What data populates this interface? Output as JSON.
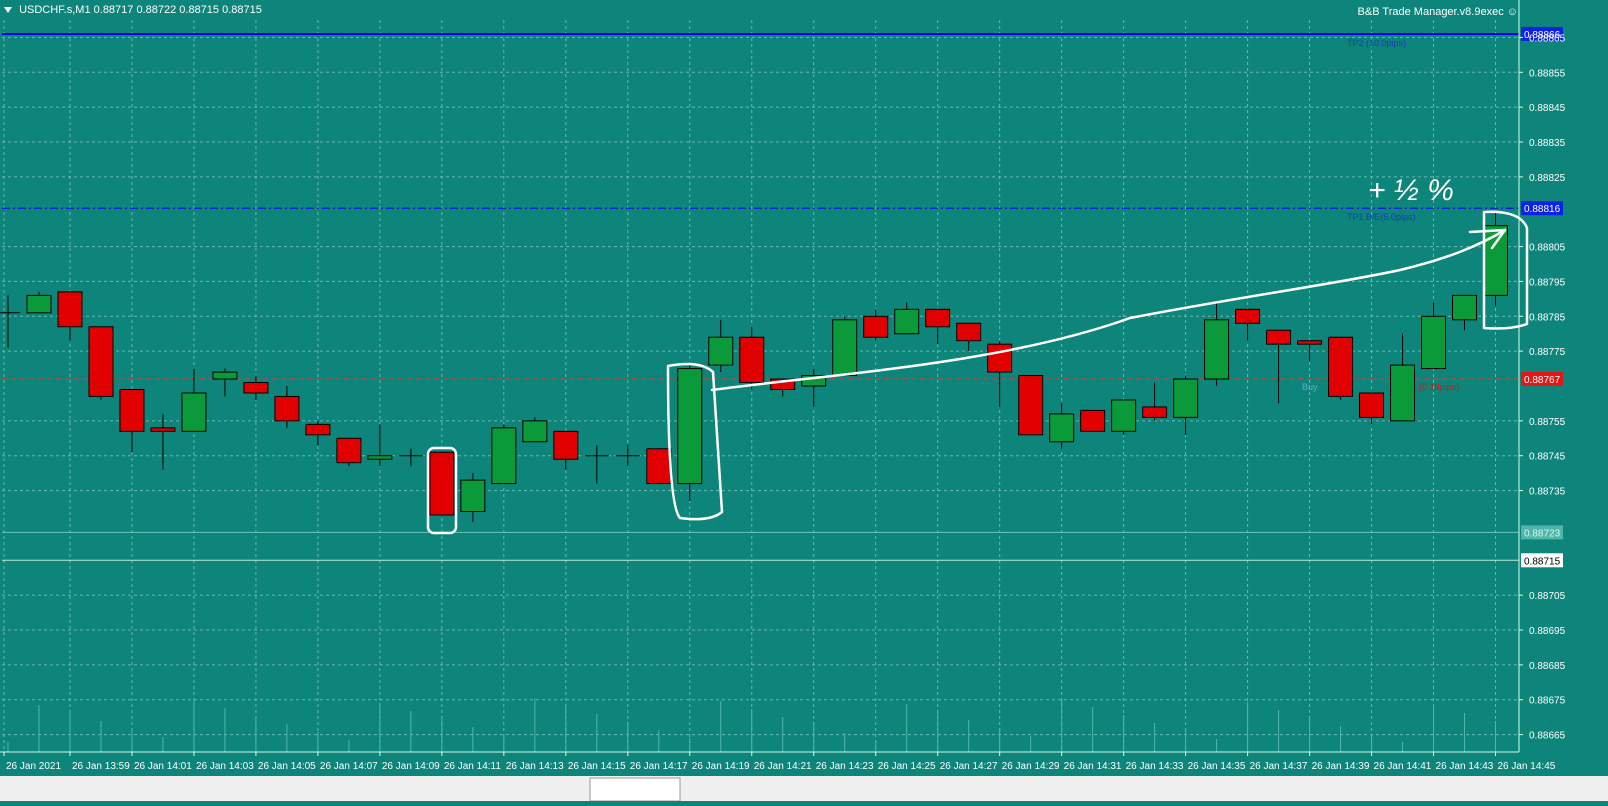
{
  "header": {
    "symbol": "USDCHF.s,M1",
    "ohlc": "0.88717 0.88722 0.88715 0.88715",
    "expert": "B&B Trade Manager.v8.9exec"
  },
  "annotation": {
    "handwritten": "+ ½ %"
  },
  "colors": {
    "background": "#0e857a",
    "grid": "#67b8b0",
    "bull": "#0a9a3a",
    "bear": "#e00000",
    "wick": "#000000",
    "tp_line": "#0000ee",
    "sl_line": "#ff2a2a",
    "price_tag": "#ffffff"
  },
  "chart_data": {
    "type": "candlestick",
    "ylim": [
      0.8866,
      0.8887
    ],
    "y_ticks": [
      "0.88865",
      "0.88855",
      "0.88845",
      "0.88835",
      "0.88825",
      "0.88805",
      "0.88795",
      "0.88785",
      "0.88775",
      "0.88755",
      "0.88745",
      "0.88735",
      "0.88705",
      "0.88695",
      "0.88685",
      "0.88675",
      "0.88665"
    ],
    "x_ticks": [
      "26 Jan 2021",
      "26 Jan 13:59",
      "26 Jan 14:01",
      "26 Jan 14:03",
      "26 Jan 14:05",
      "26 Jan 14:07",
      "26 Jan 14:09",
      "26 Jan 14:11",
      "26 Jan 14:13",
      "26 Jan 14:15",
      "26 Jan 14:17",
      "26 Jan 14:19",
      "26 Jan 14:21",
      "26 Jan 14:23",
      "26 Jan 14:25",
      "26 Jan 14:27",
      "26 Jan 14:29",
      "26 Jan 14:31",
      "26 Jan 14:33",
      "26 Jan 14:35",
      "26 Jan 14:37",
      "26 Jan 14:39",
      "26 Jan 14:41",
      "26 Jan 14:43",
      "26 Jan 14:45"
    ],
    "candles": [
      {
        "o": 0.88786,
        "h": 0.88791,
        "l": 0.88776,
        "c": 0.88786
      },
      {
        "o": 0.88786,
        "h": 0.88792,
        "l": 0.88786,
        "c": 0.88791
      },
      {
        "o": 0.88792,
        "h": 0.88792,
        "l": 0.88778,
        "c": 0.88782
      },
      {
        "o": 0.88782,
        "h": 0.88782,
        "l": 0.88761,
        "c": 0.88762
      },
      {
        "o": 0.88764,
        "h": 0.88764,
        "l": 0.88746,
        "c": 0.88752
      },
      {
        "o": 0.88753,
        "h": 0.88757,
        "l": 0.88741,
        "c": 0.88752
      },
      {
        "o": 0.88752,
        "h": 0.8877,
        "l": 0.88752,
        "c": 0.88763
      },
      {
        "o": 0.88767,
        "h": 0.8877,
        "l": 0.88762,
        "c": 0.88769
      },
      {
        "o": 0.88766,
        "h": 0.88768,
        "l": 0.88761,
        "c": 0.88763
      },
      {
        "o": 0.88762,
        "h": 0.88765,
        "l": 0.88753,
        "c": 0.88755
      },
      {
        "o": 0.88754,
        "h": 0.88755,
        "l": 0.88748,
        "c": 0.88751
      },
      {
        "o": 0.8875,
        "h": 0.8875,
        "l": 0.88742,
        "c": 0.88743
      },
      {
        "o": 0.88744,
        "h": 0.88754,
        "l": 0.88742,
        "c": 0.88745
      },
      {
        "o": 0.88745,
        "h": 0.88747,
        "l": 0.88742,
        "c": 0.88745
      },
      {
        "o": 0.88746,
        "h": 0.88746,
        "l": 0.88728,
        "c": 0.88728
      },
      {
        "o": 0.88729,
        "h": 0.8874,
        "l": 0.88726,
        "c": 0.88738
      },
      {
        "o": 0.88737,
        "h": 0.88754,
        "l": 0.88737,
        "c": 0.88753
      },
      {
        "o": 0.88749,
        "h": 0.88756,
        "l": 0.88749,
        "c": 0.88755
      },
      {
        "o": 0.88752,
        "h": 0.88752,
        "l": 0.88741,
        "c": 0.88744
      },
      {
        "o": 0.88745,
        "h": 0.88748,
        "l": 0.88737,
        "c": 0.88745
      },
      {
        "o": 0.88745,
        "h": 0.88748,
        "l": 0.88742,
        "c": 0.88745
      },
      {
        "o": 0.88747,
        "h": 0.88747,
        "l": 0.88737,
        "c": 0.88737
      },
      {
        "o": 0.88737,
        "h": 0.88771,
        "l": 0.88732,
        "c": 0.8877
      },
      {
        "o": 0.88771,
        "h": 0.88784,
        "l": 0.88769,
        "c": 0.88779
      },
      {
        "o": 0.88779,
        "h": 0.88782,
        "l": 0.88764,
        "c": 0.88766
      },
      {
        "o": 0.88767,
        "h": 0.88767,
        "l": 0.88762,
        "c": 0.88764
      },
      {
        "o": 0.88765,
        "h": 0.8877,
        "l": 0.88759,
        "c": 0.88768
      },
      {
        "o": 0.88768,
        "h": 0.88785,
        "l": 0.88768,
        "c": 0.88784
      },
      {
        "o": 0.88785,
        "h": 0.88787,
        "l": 0.88778,
        "c": 0.88779
      },
      {
        "o": 0.8878,
        "h": 0.88789,
        "l": 0.8878,
        "c": 0.88787
      },
      {
        "o": 0.88787,
        "h": 0.88787,
        "l": 0.88777,
        "c": 0.88782
      },
      {
        "o": 0.88783,
        "h": 0.88783,
        "l": 0.88775,
        "c": 0.88778
      },
      {
        "o": 0.88777,
        "h": 0.88778,
        "l": 0.88759,
        "c": 0.88769
      },
      {
        "o": 0.88768,
        "h": 0.88768,
        "l": 0.88751,
        "c": 0.88751
      },
      {
        "o": 0.88749,
        "h": 0.8876,
        "l": 0.88747,
        "c": 0.88757
      },
      {
        "o": 0.88758,
        "h": 0.88758,
        "l": 0.88753,
        "c": 0.88752
      },
      {
        "o": 0.88752,
        "h": 0.88761,
        "l": 0.88751,
        "c": 0.88761
      },
      {
        "o": 0.88759,
        "h": 0.88766,
        "l": 0.88755,
        "c": 0.88756
      },
      {
        "o": 0.88756,
        "h": 0.88768,
        "l": 0.88751,
        "c": 0.88767
      },
      {
        "o": 0.88767,
        "h": 0.88789,
        "l": 0.88765,
        "c": 0.88784
      },
      {
        "o": 0.88787,
        "h": 0.88787,
        "l": 0.88778,
        "c": 0.88783
      },
      {
        "o": 0.88781,
        "h": 0.88781,
        "l": 0.8876,
        "c": 0.88777
      },
      {
        "o": 0.88778,
        "h": 0.88778,
        "l": 0.88772,
        "c": 0.88777
      },
      {
        "o": 0.88779,
        "h": 0.88779,
        "l": 0.88761,
        "c": 0.88762
      },
      {
        "o": 0.88763,
        "h": 0.88763,
        "l": 0.88754,
        "c": 0.88756
      },
      {
        "o": 0.88755,
        "h": 0.8878,
        "l": 0.88755,
        "c": 0.88771
      },
      {
        "o": 0.8877,
        "h": 0.88789,
        "l": 0.8877,
        "c": 0.88785
      },
      {
        "o": 0.88784,
        "h": 0.88791,
        "l": 0.88781,
        "c": 0.88791
      },
      {
        "o": 0.88791,
        "h": 0.88815,
        "l": 0.88788,
        "c": 0.88811
      }
    ],
    "levels": [
      {
        "name": "tp2",
        "price": 0.88866,
        "label": "TP2 (10.0pips)",
        "tag": "0.88866",
        "style": "solid"
      },
      {
        "name": "tp1",
        "price": 0.88816,
        "label": "TP1 B/E(5.0pips)",
        "tag": "0.88816",
        "style": "dashdot"
      },
      {
        "name": "sl",
        "price": 0.88767,
        "label": "SL (0.18pips)",
        "tag": "0.88767",
        "style": "dashed"
      },
      {
        "name": "buy",
        "price": 0.88767,
        "label": "Buy",
        "tag": "",
        "style": "none"
      },
      {
        "name": "ask",
        "price": 0.88723,
        "label": "",
        "tag": "0.88723",
        "style": "faint"
      },
      {
        "name": "bid",
        "price": 0.88715,
        "label": "",
        "tag": "0.88715",
        "style": "thin"
      }
    ]
  }
}
